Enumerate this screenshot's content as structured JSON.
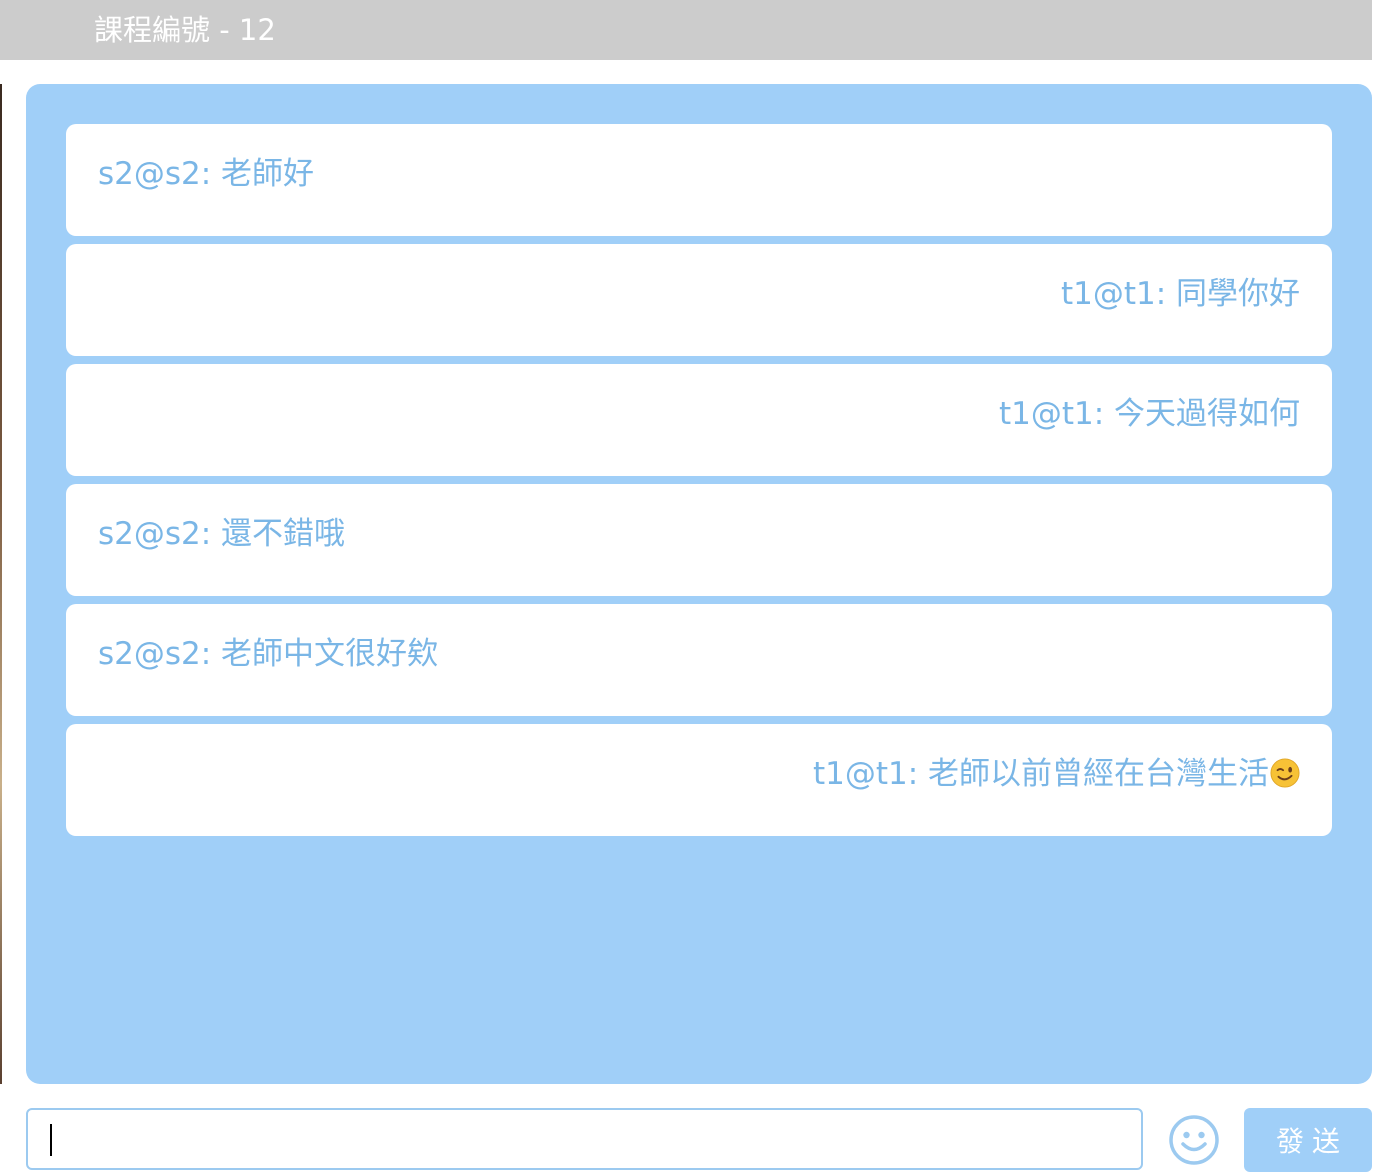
{
  "header": {
    "title": "課程編號 - 12"
  },
  "chat": {
    "messages": [
      {
        "sender": "s2@s2",
        "text": "老師好",
        "display": "s2@s2: 老師好",
        "align": "left"
      },
      {
        "sender": "t1@t1",
        "text": "同學你好",
        "display": "t1@t1: 同學你好",
        "align": "right"
      },
      {
        "sender": "t1@t1",
        "text": "今天過得如何",
        "display": "t1@t1: 今天過得如何",
        "align": "right"
      },
      {
        "sender": "s2@s2",
        "text": "還不錯哦",
        "display": "s2@s2: 還不錯哦",
        "align": "left"
      },
      {
        "sender": "s2@s2",
        "text": "老師中文很好欸",
        "display": "s2@s2: 老師中文很好欸",
        "align": "left"
      },
      {
        "sender": "t1@t1",
        "text": "老師以前曾經在台灣生活",
        "display": "t1@t1: 老師以前曾經在台灣生活",
        "align": "right",
        "emoji": "winking-face"
      }
    ]
  },
  "composer": {
    "input_value": "",
    "emoji_icon": "smiley-icon",
    "send_label": "發送"
  },
  "colors": {
    "header_bg": "#cccccc",
    "panel_bg": "#a0cff8",
    "message_text": "#7ab6e6",
    "button_bg": "#a0cff8"
  }
}
